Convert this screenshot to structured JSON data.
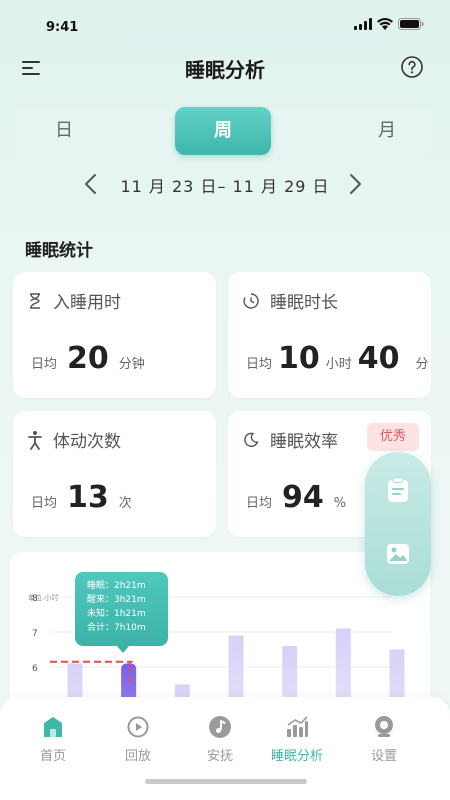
{
  "status": {
    "time": "9:41"
  },
  "header": {
    "title": "睡眠分析"
  },
  "segments": {
    "day": "日",
    "week": "周",
    "month": "月",
    "selected": "周"
  },
  "date_range": "11 月 23 日– 11 月 29 日",
  "section": {
    "title": "睡眠统计"
  },
  "cards": {
    "sleep_onset": {
      "title": "入睡用时",
      "avg_label": "日均",
      "value": "20",
      "unit": "分钟"
    },
    "sleep_duration": {
      "title": "睡眠时长",
      "avg_label": "日均",
      "hours": "10",
      "hours_unit": "小时",
      "minutes": "40",
      "minutes_unit": "分"
    },
    "movement": {
      "title": "体动次数",
      "avg_label": "日均",
      "value": "13",
      "unit": "次"
    },
    "efficiency": {
      "title": "睡眠效率",
      "avg_label": "日均",
      "value": "94",
      "unit": "%",
      "badge": "优秀"
    }
  },
  "chart_data": {
    "type": "bar",
    "ylabel": "单位:小时",
    "yticks": [
      6,
      7,
      8
    ],
    "ylim": [
      5,
      9
    ],
    "values": [
      6.1,
      6.1,
      5.5,
      6.9,
      6.6,
      7.1,
      6.5
    ],
    "highlight_index": 1,
    "reference_line": 6.15,
    "tooltip": {
      "sleep": "睡眠：2h21m",
      "awake": "醒来：3h21m",
      "unknown": "未知：1h21m",
      "total": "合计：7h10m"
    }
  },
  "tabbar": {
    "items": [
      {
        "label": "首页",
        "icon": "home-icon"
      },
      {
        "label": "回放",
        "icon": "replay-icon"
      },
      {
        "label": "安抚",
        "icon": "music-icon"
      },
      {
        "label": "睡眠分析",
        "icon": "chart-icon"
      },
      {
        "label": "设置",
        "icon": "settings-icon"
      }
    ],
    "active": "睡眠分析"
  },
  "colors": {
    "accent": "#3fb7ab",
    "bar": "#d7d2f7",
    "bar_highlight": "#7c5ee8",
    "reference": "#e84a4a",
    "badge_text": "#e05a5a"
  }
}
